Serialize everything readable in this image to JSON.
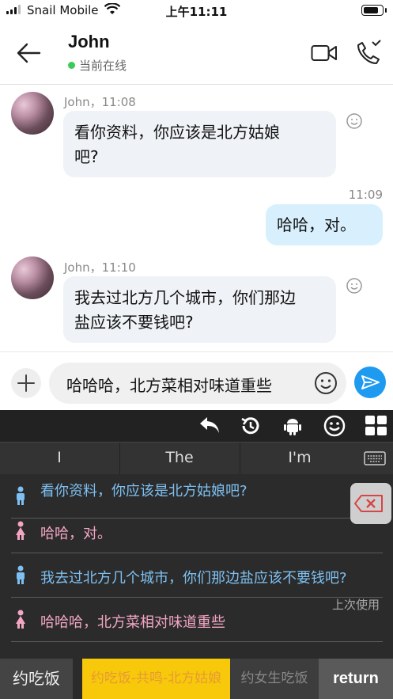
{
  "status_bar": {
    "carrier": "Snail Mobile",
    "time": "上午11:11"
  },
  "header": {
    "title": "John",
    "status": "当前在线"
  },
  "messages": [
    {
      "sender": "John，11:08",
      "text_line1": "看你资料，你应该是北方姑娘",
      "text_line2": "吧?"
    },
    {
      "time": "11:09",
      "text": "哈哈，对。"
    },
    {
      "sender": "John，11:10",
      "text_line1": "我去过北方几个城市，你们那边",
      "text_line2": "盐应该不要钱吧?"
    }
  ],
  "input": {
    "value": "哈哈哈，北方菜相对味道重些"
  },
  "keyboard": {
    "suggestions": [
      "I",
      "The",
      "I'm"
    ],
    "phrases": [
      {
        "gender": "male",
        "text": "看你资料，你应该是北方姑娘吧?"
      },
      {
        "gender": "female",
        "text": "哈哈，对。"
      },
      {
        "gender": "male",
        "text": "我去过北方几个城市，你们那边盐应该不要钱吧?"
      },
      {
        "gender": "female",
        "text": "哈哈哈，北方菜相对味道重些"
      }
    ],
    "last_used_label": "上次使用",
    "bottom": {
      "tab1": "约吃饭",
      "tab2": "约吃饭-共鸣-北方姑娘",
      "tab3": "约女生吃饭",
      "return": "return"
    }
  },
  "colors": {
    "accent": "#1e9bf0",
    "online": "#3ccb5a",
    "incoming_bubble": "#eff2f6",
    "outgoing_bubble": "#d8f0fd",
    "highlight": "#f8c90b"
  }
}
